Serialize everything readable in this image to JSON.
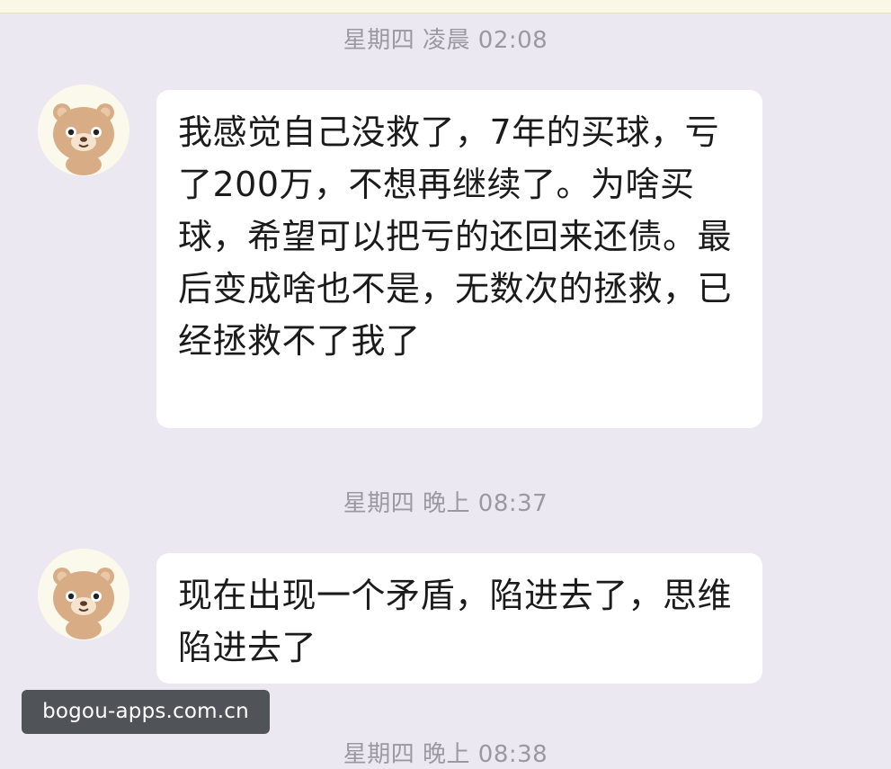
{
  "chat": {
    "messages": [
      {
        "timestamp": "星期四 凌晨 02:08",
        "avatar_icon": "bear-avatar-icon",
        "text": "我感觉自己没救了，7年的买球，亏了200万，不想再继续了。为啥买球，希望可以把亏的还回来还债。最后变成啥也不是，无数次的拯救，已经拯救不了我了"
      },
      {
        "timestamp": "星期四 晚上 08:37",
        "avatar_icon": "bear-avatar-icon",
        "text": "现在出现一个矛盾，陷进去了，思维陷进去了"
      }
    ],
    "partial_timestamp": "星期四 晚上 08:38"
  },
  "watermark": {
    "text": "bogou-apps.com.cn"
  },
  "colors": {
    "background": "#ece8f1",
    "bubble": "#ffffff",
    "timestamp_text": "#9a99a0",
    "watermark_bg": "#32373c",
    "bear_fur": "#d8ad86"
  }
}
